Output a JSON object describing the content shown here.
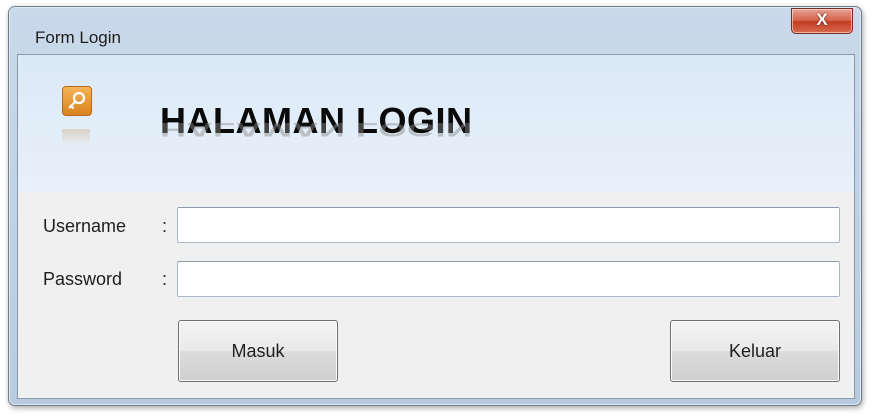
{
  "window": {
    "title": "Form Login",
    "close_label": "X"
  },
  "banner": {
    "icon": "key-icon",
    "heading": "HALAMAN LOGIN"
  },
  "form": {
    "username_label": "Username",
    "password_label": "Password",
    "colon": ":",
    "username_value": "",
    "password_value": ""
  },
  "buttons": {
    "login_label": "Masuk",
    "exit_label": "Keluar"
  },
  "colors": {
    "banner_bg": "#dbe9f6",
    "close_button": "#c23b22",
    "icon_orange": "#e08a22"
  }
}
